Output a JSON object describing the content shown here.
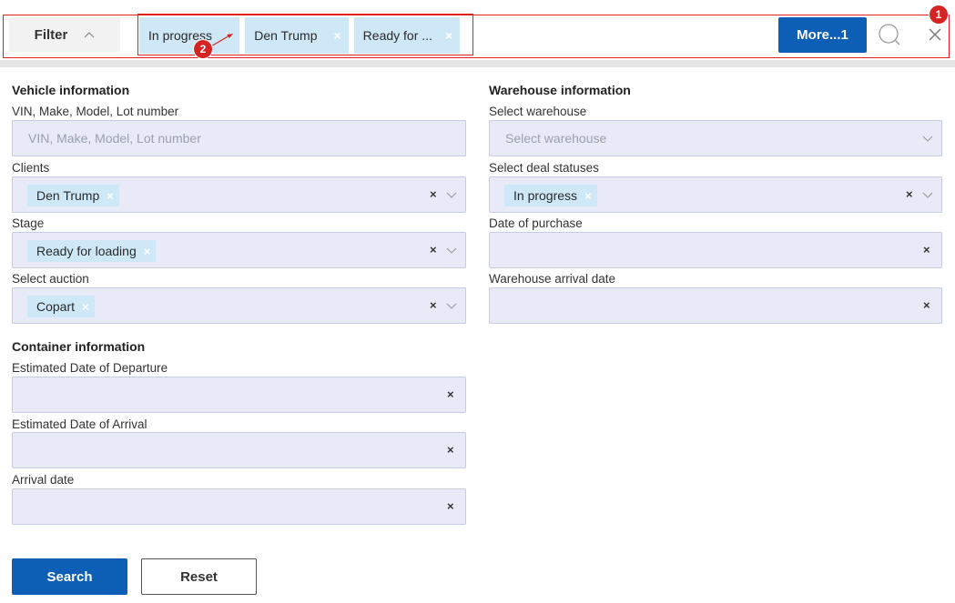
{
  "topbar": {
    "filter_label": "Filter",
    "chips": [
      {
        "label": "In progress"
      },
      {
        "label": "Den Trump"
      },
      {
        "label": "Ready for ..."
      }
    ],
    "more_label": "More...1",
    "chip_remove": "×"
  },
  "annotations": {
    "badge_1": "1",
    "badge_2": "2"
  },
  "vehicle": {
    "title": "Vehicle information",
    "vin_label": "VIN, Make, Model, Lot number",
    "vin_placeholder": "VIN, Make, Model, Lot number",
    "clients_label": "Clients",
    "clients_tag": "Den Trump",
    "stage_label": "Stage",
    "stage_tag": "Ready for loading",
    "auction_label": "Select auction",
    "auction_tag": "Copart"
  },
  "warehouse": {
    "title": "Warehouse information",
    "warehouse_label": "Select warehouse",
    "warehouse_placeholder": "Select warehouse",
    "deal_label": "Select deal statuses",
    "deal_tag": "In progress",
    "purchase_label": "Date of purchase",
    "arrival_label": "Warehouse arrival date"
  },
  "container": {
    "title": "Container information",
    "etd_label": "Estimated Date of Departure",
    "eta_label": "Estimated Date of Arrival",
    "arrival_label": "Arrival date"
  },
  "common": {
    "clear": "×",
    "tag_remove": "×"
  },
  "actions": {
    "search_label": "Search",
    "reset_label": "Reset"
  },
  "colors": {
    "primary": "#0d5fb5",
    "chip_bg": "#cfe8f8",
    "field_bg": "#e8ebf7",
    "annotation_red": "#d52424"
  }
}
